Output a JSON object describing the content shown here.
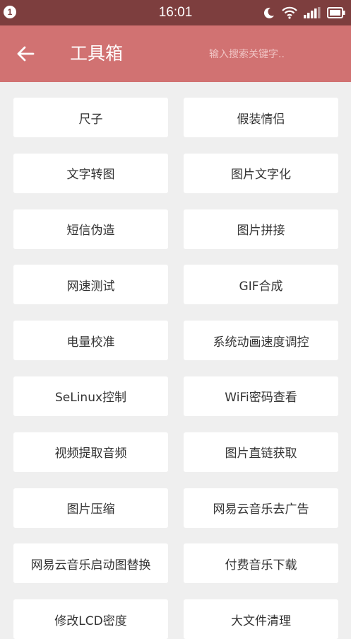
{
  "status_bar": {
    "notification_count": "1",
    "time": "16:01",
    "icons": [
      "moon-icon",
      "wifi-icon",
      "signal-icon",
      "battery-icon"
    ]
  },
  "app_bar": {
    "title": "工具箱",
    "search_placeholder": "输入搜索关键字..",
    "back_icon": "arrow-left-icon"
  },
  "colors": {
    "status_bar": "#7d3e3e",
    "app_bar": "#d17272",
    "background": "#efefef",
    "button": "#ffffff",
    "button_text": "#333333"
  },
  "tools": [
    "尺子",
    "假装情侣",
    "文字转图",
    "图片文字化",
    "短信伪造",
    "图片拼接",
    "网速测试",
    "GIF合成",
    "电量校准",
    "系统动画速度调控",
    "SeLinux控制",
    "WiFi密码查看",
    "视频提取音频",
    "图片直链获取",
    "图片压缩",
    "网易云音乐去广告",
    "网易云音乐启动图替换",
    "付费音乐下载",
    "修改LCD密度",
    "大文件清理"
  ]
}
